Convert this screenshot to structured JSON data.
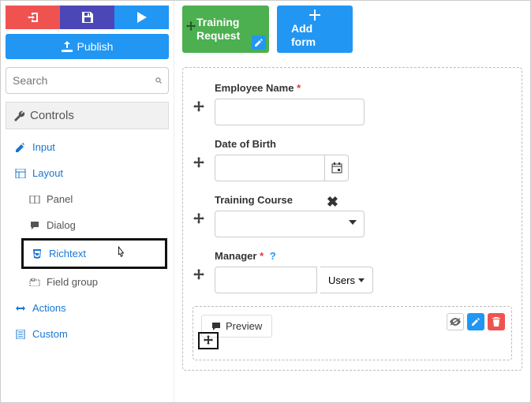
{
  "toolbar": {
    "publish_label": "Publish"
  },
  "search": {
    "placeholder": "Search"
  },
  "controls_header": "Controls",
  "tree": {
    "input": "Input",
    "layout": "Layout",
    "layout_children": {
      "panel": "Panel",
      "dialog": "Dialog",
      "richtext": "Richtext",
      "fieldgroup": "Field group"
    },
    "actions": "Actions",
    "custom": "Custom"
  },
  "tiles": {
    "training_request": "Training Request",
    "add_form": "Add form"
  },
  "form": {
    "employee_name": {
      "label": "Employee Name",
      "value": ""
    },
    "dob": {
      "label": "Date of Birth",
      "value": ""
    },
    "training_course": {
      "label": "Training Course",
      "value": ""
    },
    "manager": {
      "label": "Manager",
      "value": "",
      "picker_label": "Users"
    }
  },
  "preview": {
    "tab_label": "Preview"
  }
}
